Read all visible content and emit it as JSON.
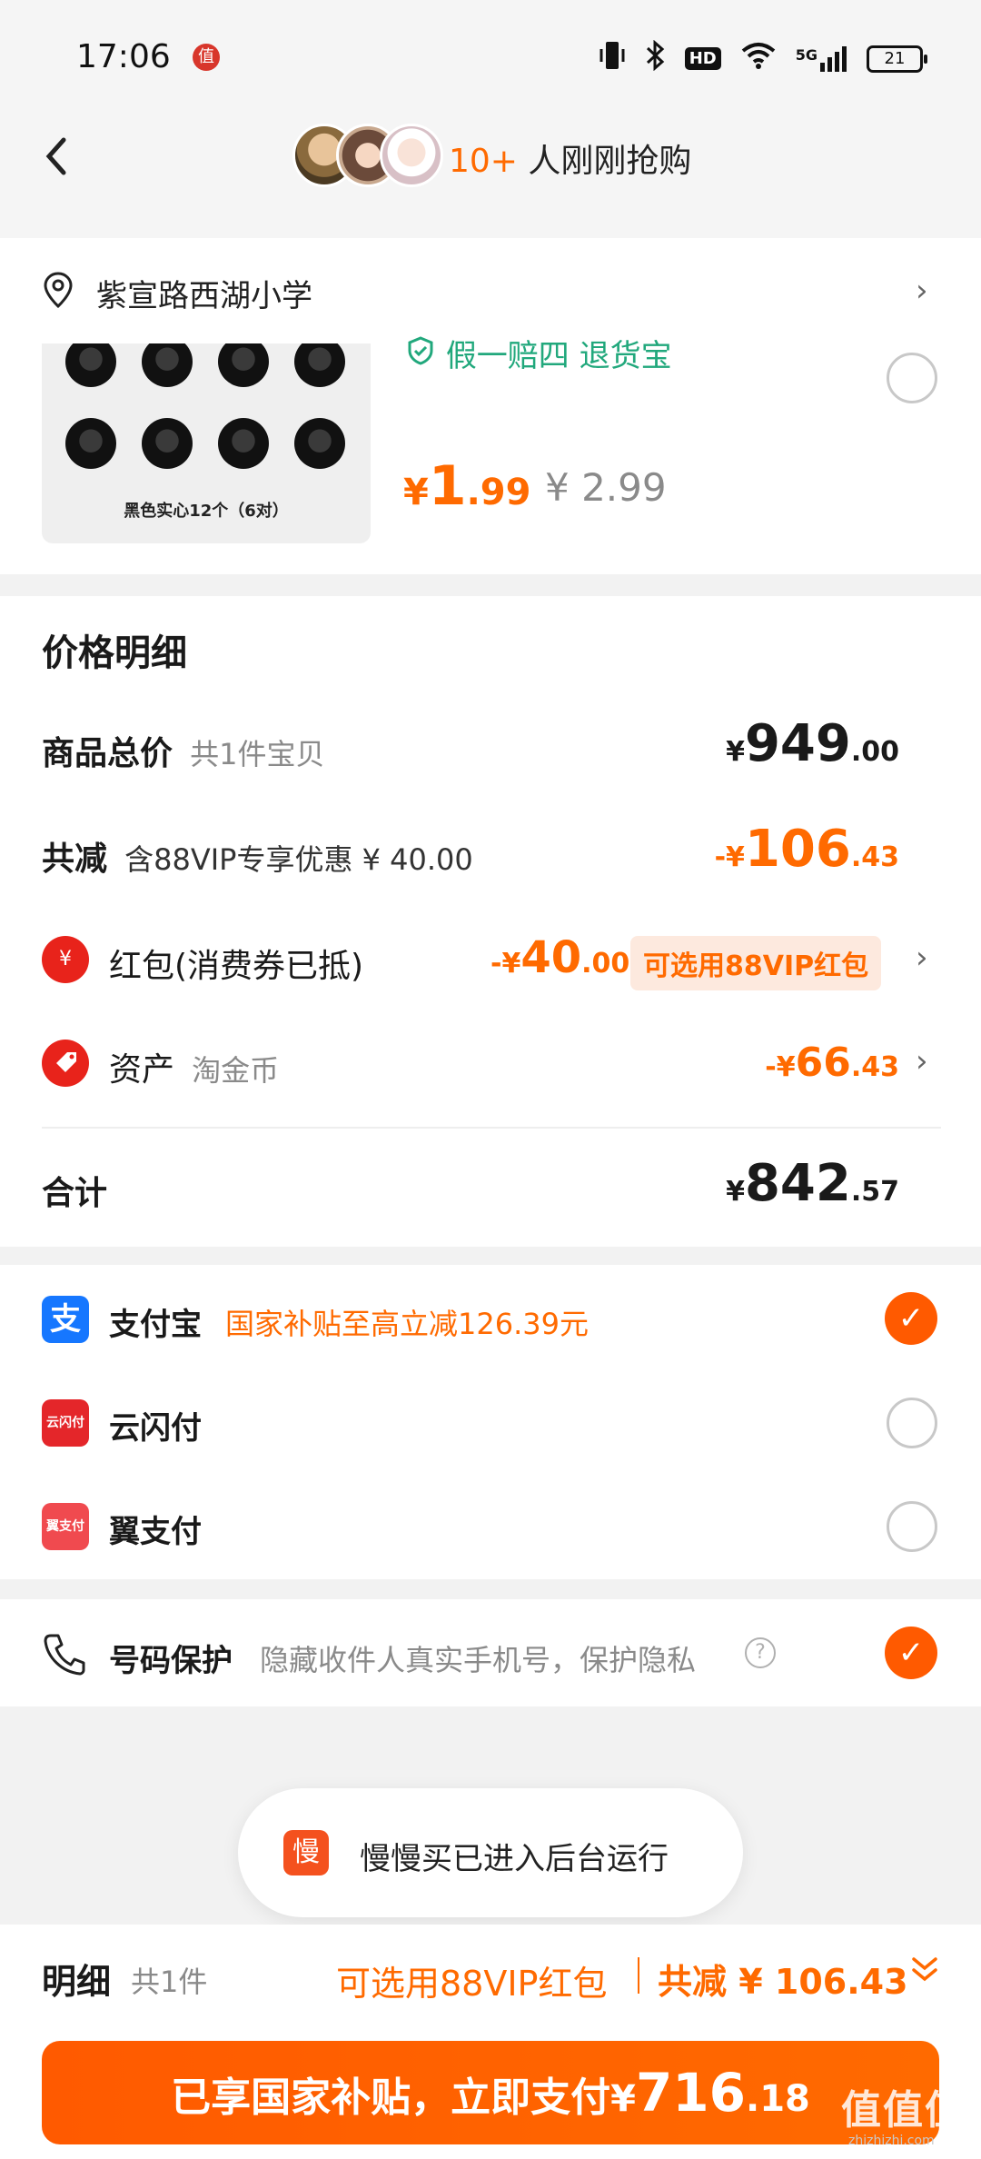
{
  "status_bar": {
    "time": "17:06",
    "badge": "值",
    "network": "5G",
    "hd": "HD",
    "battery": "21"
  },
  "header": {
    "buyer_count": "10+",
    "buyer_text": " 人刚刚抢购"
  },
  "address": {
    "text": "紫宣路西湖小学"
  },
  "product": {
    "image_label": "黑色实心12个（6对）",
    "guarantee": "假一赔四  退货宝",
    "price_symbol": "¥",
    "price_int": "1",
    "price_dec": ".99",
    "original_price": "¥ 2.99"
  },
  "price_details": {
    "title": "价格明细",
    "subtotal": {
      "label": "商品总价",
      "sub": "共1件宝贝",
      "sym": "¥",
      "int": "949",
      "dec": ".00"
    },
    "discount": {
      "label": "共减",
      "sub": "含88VIP专享优惠 ¥ 40.00",
      "sym": "-¥",
      "int": "106",
      "dec": ".43"
    },
    "redpacket": {
      "icon": "¥",
      "label": "红包(消费券已抵)",
      "sym": "-¥",
      "int": "40",
      "dec": ".00",
      "pill": "可选用88VIP红包"
    },
    "assets": {
      "label": "资产",
      "sub": "淘金币",
      "sym": "-¥",
      "int": "66",
      "dec": ".43"
    },
    "total": {
      "label": "合计",
      "sym": "¥",
      "int": "842",
      "dec": ".57"
    }
  },
  "payments": {
    "alipay": {
      "icon": "支",
      "label": "支付宝",
      "promo": "国家补贴至高立减126.39元",
      "selected": true
    },
    "unionpay": {
      "icon": "云闪付",
      "label": "云闪付",
      "selected": false
    },
    "bestpay": {
      "icon": "翼支付",
      "label": "翼支付",
      "selected": false
    }
  },
  "protection": {
    "label": "号码保护",
    "desc": "隐藏收件人真实手机号，保护隐私"
  },
  "toast": {
    "icon": "慢",
    "text": "慢慢买已进入后台运行"
  },
  "bottom": {
    "detail_label": "明细",
    "detail_count": "共1件",
    "vip_text": "可选用88VIP红包",
    "total_text": "共减 ¥ 106.43",
    "pay_text": "已享国家补贴，立即支付",
    "pay_sym": "¥",
    "pay_int": "716",
    "pay_dec": ".18"
  },
  "watermark": {
    "text": "值值值",
    "url": "zhizhizhi.com"
  },
  "colors": {
    "accent": "#ff6a00",
    "green": "#21a87c",
    "alipay": "#1677ff",
    "red": "#e8231b"
  }
}
